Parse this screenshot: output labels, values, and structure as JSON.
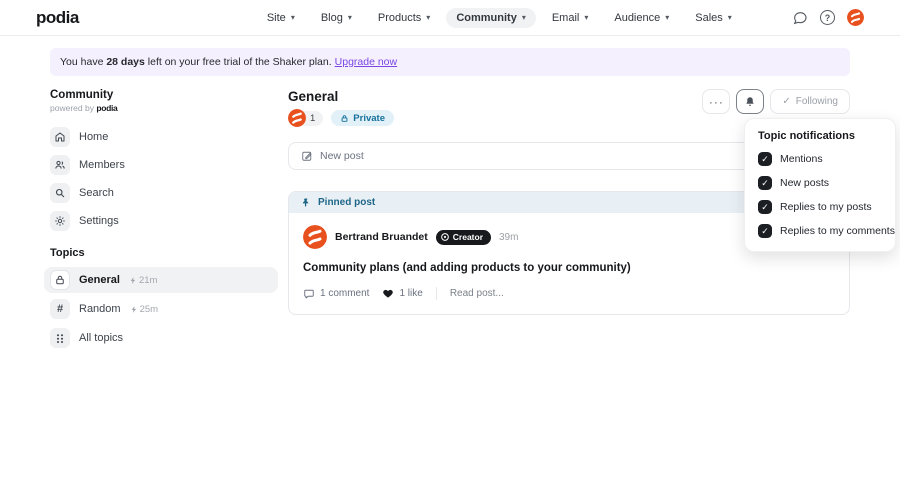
{
  "icons": {
    "caret": "▾",
    "more": "···",
    "check": "✓",
    "help": "?"
  },
  "nav": {
    "logo": "podia",
    "items": [
      {
        "label": "Site"
      },
      {
        "label": "Blog"
      },
      {
        "label": "Products"
      },
      {
        "label": "Community"
      },
      {
        "label": "Email"
      },
      {
        "label": "Audience"
      },
      {
        "label": "Sales"
      }
    ]
  },
  "banner": {
    "text_before": "You have ",
    "bold": "28 days",
    "text_after": " left on your free trial of the Shaker plan.",
    "link": "Upgrade now"
  },
  "sidebar": {
    "title": "Community",
    "powered_by": "powered by ",
    "powered_brand": "podia",
    "items": [
      {
        "label": "Home"
      },
      {
        "label": "Members"
      },
      {
        "label": "Search"
      },
      {
        "label": "Settings"
      }
    ],
    "topics_heading": "Topics",
    "topics": [
      {
        "label": "General",
        "meta": "21m"
      },
      {
        "label": "Random",
        "meta": "25m"
      },
      {
        "label": "All topics",
        "meta": ""
      }
    ],
    "hash_glyph": "#"
  },
  "main": {
    "title": "General",
    "member_count": "1",
    "private_badge": "Private",
    "following_label": "Following",
    "new_post_label": "New post"
  },
  "dropdown": {
    "title": "Topic notifications",
    "options": [
      {
        "label": "Mentions",
        "checked": true
      },
      {
        "label": "New posts",
        "checked": true
      },
      {
        "label": "Replies to my posts",
        "checked": true
      },
      {
        "label": "Replies to my comments",
        "checked": true
      }
    ]
  },
  "post": {
    "pinned_label": "Pinned post",
    "author": "Bertrand Bruandet",
    "badge": "Creator",
    "time": "39m",
    "title": "Community plans (and adding products to your community)",
    "comments": "1 comment",
    "likes": "1 like",
    "read_more": "Read post..."
  },
  "colors": {
    "accent_purple": "#7b46e3",
    "brand_orange": "#e8501e",
    "private_badge_bg": "#e2f0f8",
    "private_badge_text": "#15719b",
    "pinned_bg": "#e9f0f5",
    "pinned_text": "#1e6687"
  }
}
